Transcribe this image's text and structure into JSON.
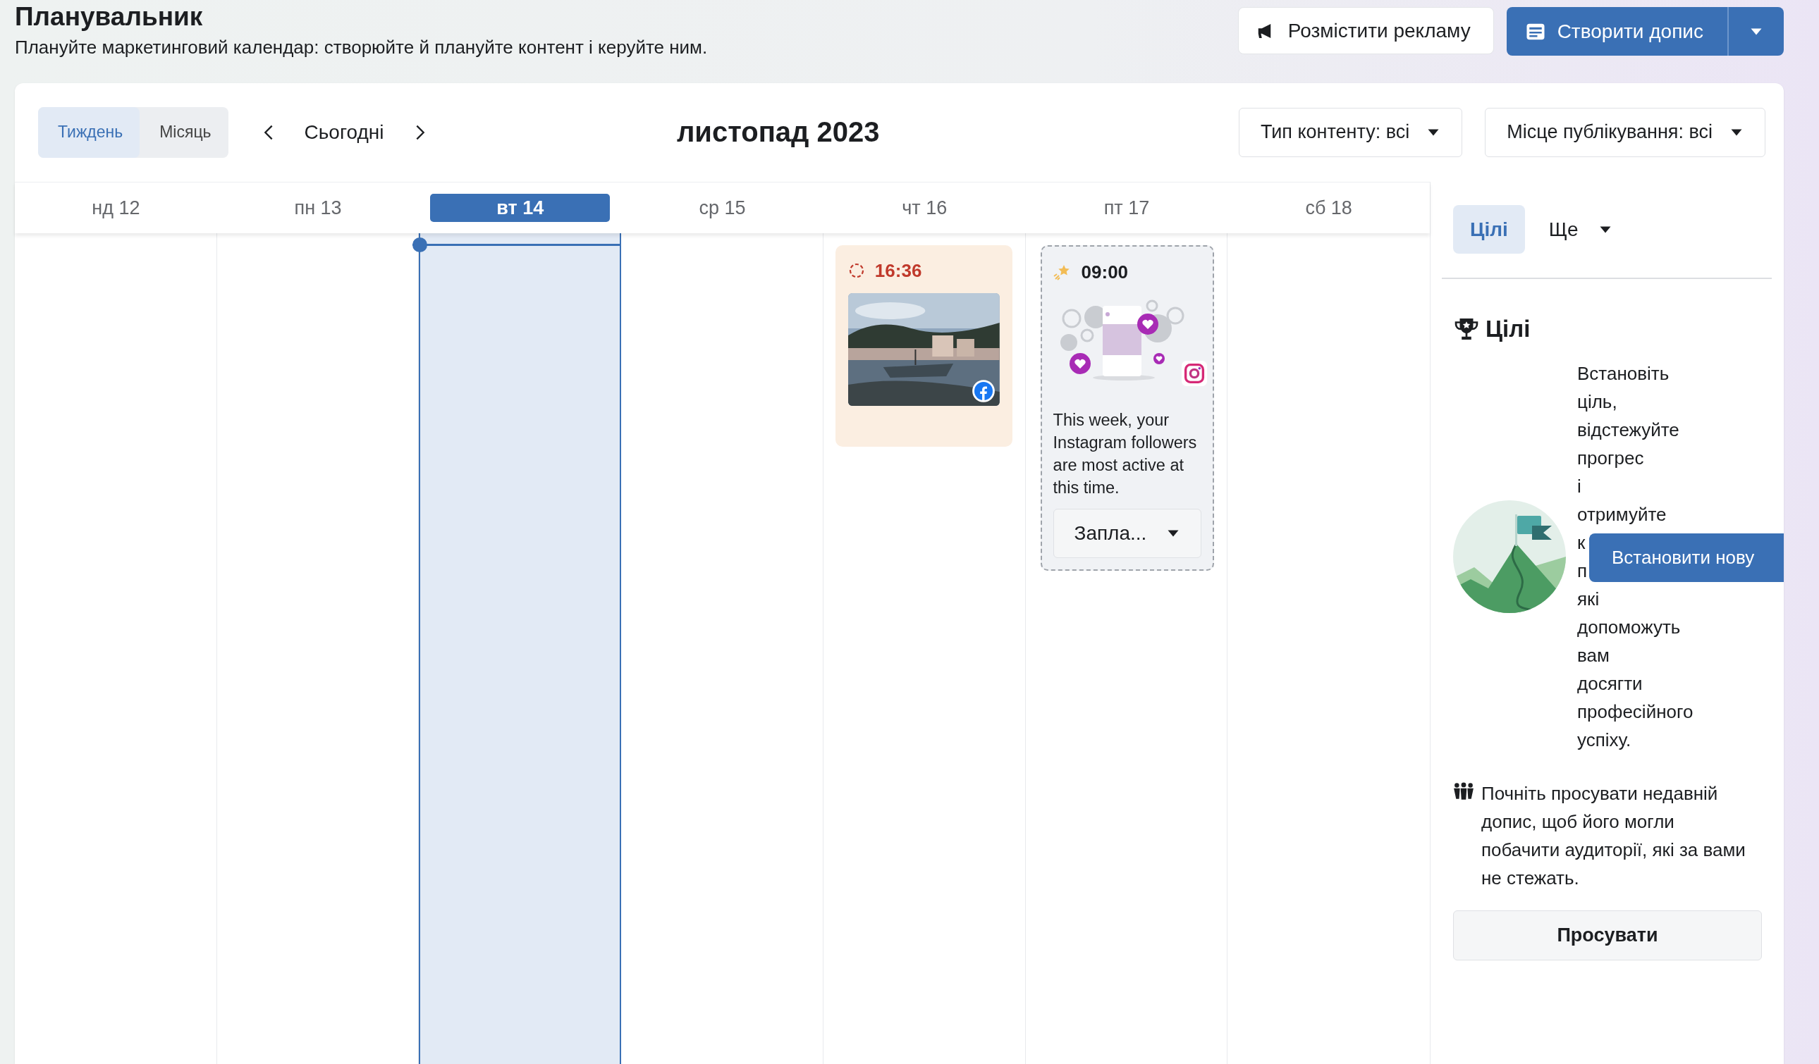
{
  "header": {
    "title": "Планувальник",
    "subtitle": "Плануйте маркетинговий календар: створюйте й плануйте контент і керуйте ним.",
    "buttons": [
      {
        "label": "Розмістити рекламу",
        "kind": "secondary"
      },
      {
        "label": "Створити допис",
        "kind": "primary"
      }
    ]
  },
  "toolbar": {
    "views": [
      {
        "label": "Тиждень",
        "selected": true
      },
      {
        "label": "Місяць",
        "selected": false
      }
    ],
    "today": "Сьогодні",
    "month": "листопад 2023",
    "filters": [
      "Тип контенту: всі",
      "Місце публікування: всі"
    ]
  },
  "days": [
    {
      "label": "нд 12",
      "selected": false
    },
    {
      "label": "пн 13",
      "selected": false
    },
    {
      "label": "вт 14",
      "selected": true
    },
    {
      "label": "ср 15",
      "selected": false
    },
    {
      "label": "чт 16",
      "selected": false,
      "events": [
        {
          "kind": "post",
          "time": "16:36"
        }
      ]
    },
    {
      "label": "пт 17",
      "selected": false,
      "events": [
        {
          "kind": "suggestion",
          "time": "09:00",
          "text": "This week, your Instagram followers are most active at this time.",
          "action": "Запла..."
        }
      ]
    },
    {
      "label": "сб 18",
      "selected": false
    }
  ],
  "panel": {
    "tabs": [
      {
        "label": "Цілі",
        "selected": true,
        "kind": "tab"
      },
      {
        "label": "Ще",
        "selected": false,
        "kind": "menu"
      }
    ],
    "goals": {
      "title": "Цілі",
      "lines": [
        "Встановіть",
        "ціль,",
        "відстежуйте",
        "прогрес",
        "і",
        "отримуйте",
        "к",
        "п",
        "які",
        "допоможуть",
        "вам",
        "досягти",
        "професійного",
        "успіху."
      ],
      "button": "Встановити нову"
    },
    "promo": {
      "text": "Почніть просувати недавній допис, щоб його могли побачити аудиторії, які за вами не стежать.",
      "button": "Просувати"
    }
  }
}
